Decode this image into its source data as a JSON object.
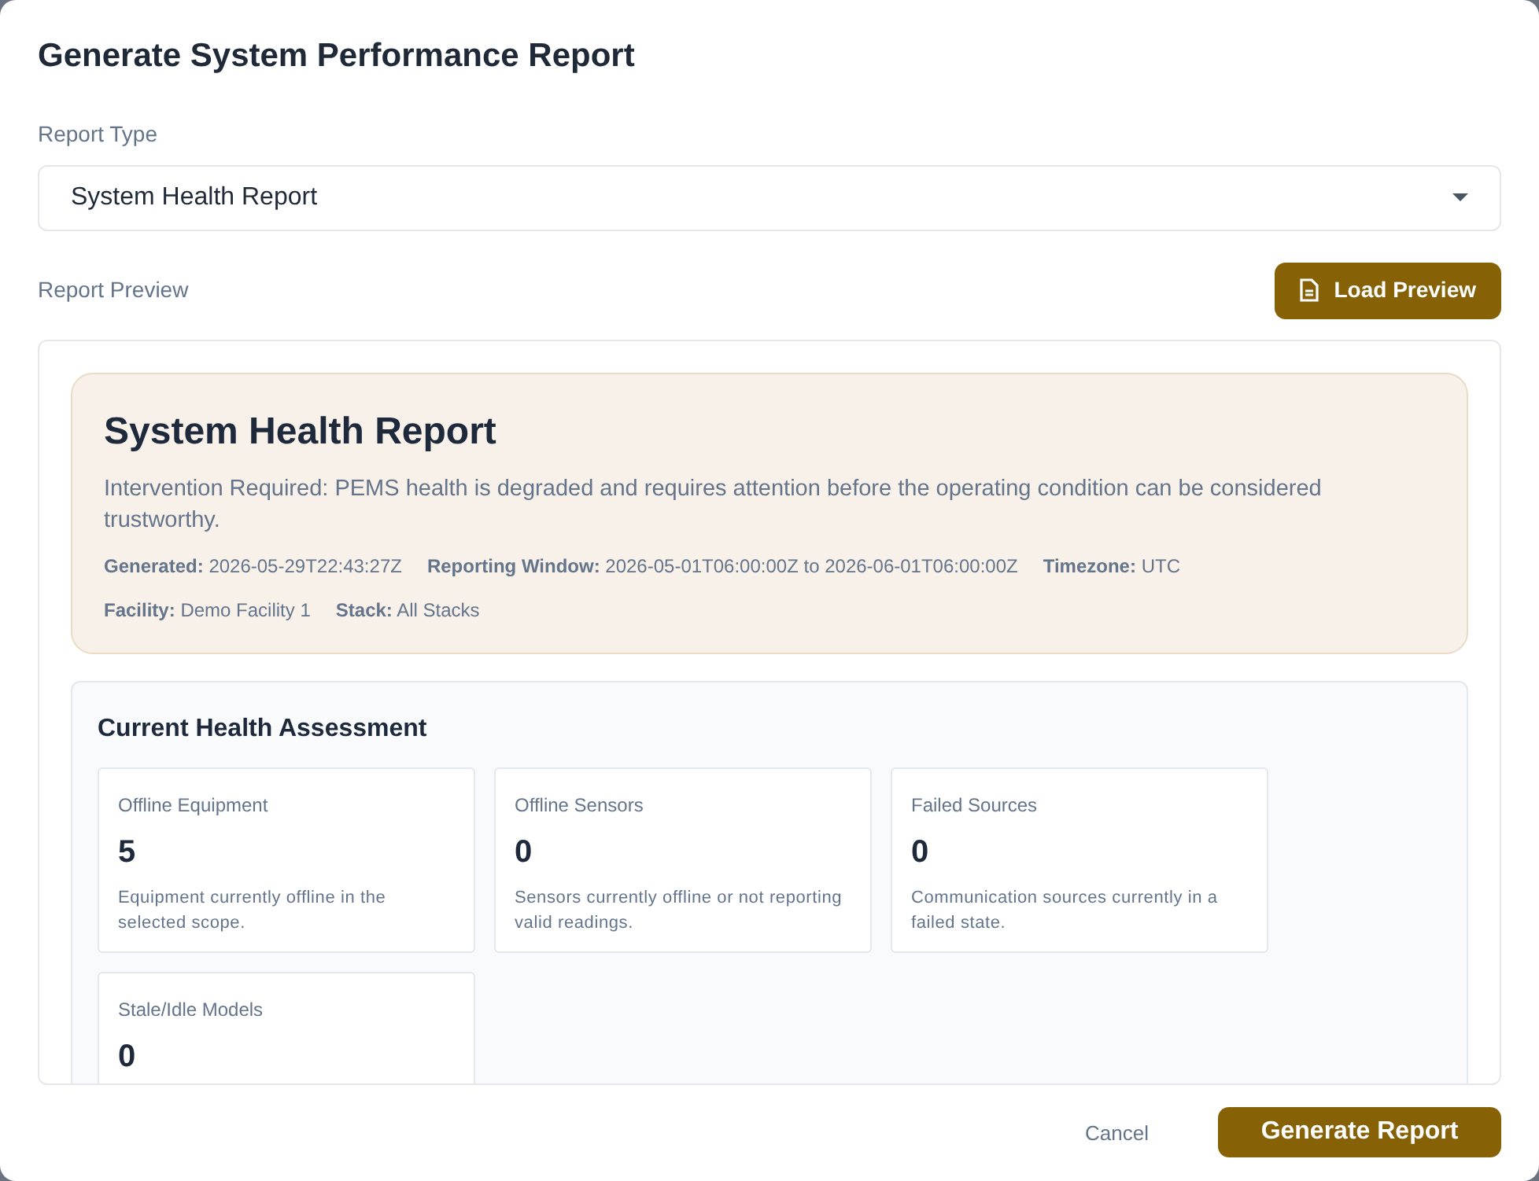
{
  "dialog": {
    "title": "Generate System Performance Report"
  },
  "report_type": {
    "label": "Report Type",
    "value": "System Health Report"
  },
  "preview": {
    "label": "Report Preview",
    "load_button": "Load Preview",
    "header": {
      "title": "System Health Report",
      "summary": "Intervention Required: PEMS health is degraded and requires attention before the operating condition can be considered trustworthy.",
      "meta_lines": [
        [
          "**Generated:** 2026-05-29T22:43:27Z",
          "**Reporting Window:** 2026-05-01T06:00:00Z to 2026-06-01T06:00:00Z",
          "**Timezone:** UTC"
        ],
        [
          "**Facility:** Demo Facility 1",
          "**Stack:** All Stacks"
        ]
      ]
    },
    "section": {
      "title": "Current Health Assessment",
      "cards": [
        {
          "label": "Offline Equipment",
          "value": "5",
          "description": "Equipment currently offline in the selected scope."
        },
        {
          "label": "Offline Sensors",
          "value": "0",
          "description": "Sensors currently offline or not reporting valid readings."
        },
        {
          "label": "Failed Sources",
          "value": "0",
          "description": "Communication sources currently in a failed state."
        },
        {
          "label": "Stale/Idle Models",
          "value": "0"
        }
      ]
    }
  },
  "buttons": {
    "cancel": "Cancel",
    "generate": "Generate Report"
  }
}
